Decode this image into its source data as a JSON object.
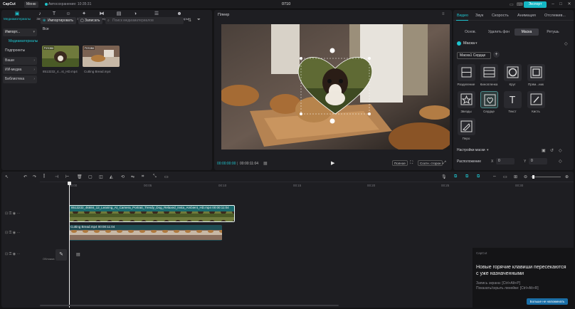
{
  "titlebar": {
    "logo": "CapCut",
    "menu": "Меню",
    "autosave": "Автосохранение: 10:35:31",
    "project_title": "0710",
    "export": "Экспорт"
  },
  "media": {
    "tabs": [
      {
        "label": "Медиаматериалы",
        "icon": "media-icon"
      },
      {
        "label": "Звук",
        "icon": "audio-icon"
      },
      {
        "label": "Текст",
        "icon": "text-icon"
      },
      {
        "label": "Стикеры",
        "icon": "sticker-icon"
      },
      {
        "label": "Эффекты",
        "icon": "effects-icon"
      },
      {
        "label": "Переходы",
        "icon": "transitions-icon"
      },
      {
        "label": "Субтитры",
        "icon": "captions-icon"
      },
      {
        "label": "Фильтры",
        "icon": "filters-icon"
      },
      {
        "label": "Корректировка",
        "icon": "adjust-icon"
      },
      {
        "label": "ИИ-аватары",
        "icon": "avatar-icon"
      }
    ],
    "sidebar": [
      {
        "label": "Импорт..."
      },
      {
        "label": "Медиаматериалы"
      },
      {
        "label": "Подпроекты"
      },
      {
        "label": "Ваши"
      },
      {
        "label": "ИИ-медиа"
      },
      {
        "label": "Библиотека"
      }
    ],
    "import_label": "Импортировать",
    "record_label": "Записать",
    "search_placeholder": "Поиск медиаматериалов",
    "all_label": "Все",
    "clips": [
      {
        "badge": "Готово",
        "name": "8513232_4...st_HD.mp4"
      },
      {
        "badge": "Готово",
        "name": "Cutting Bread.mp4"
      }
    ]
  },
  "player": {
    "title": "Плеер",
    "time_current": "00:00:00:00",
    "time_total": "00:00:11:04",
    "btn_full": "Полное",
    "btn_ratio": "Соотн. сторон"
  },
  "props": {
    "tabs": [
      "Видео",
      "Звук",
      "Скорость",
      "Анимация",
      "Отслежив..."
    ],
    "subtabs": [
      "Основ.",
      "Удалить фон",
      "Маска",
      "Ретушь"
    ],
    "mask_header": "Маска",
    "mask_selected": "Маска1 Сердце",
    "masks": [
      {
        "label": "Разделение",
        "icon": "split-mask-icon"
      },
      {
        "label": "Кинопленка",
        "icon": "filmstrip-mask-icon"
      },
      {
        "label": "Круг",
        "icon": "circle-mask-icon"
      },
      {
        "label": "Прям...ник",
        "icon": "rectangle-mask-icon"
      },
      {
        "label": "Звезды",
        "icon": "star-mask-icon"
      },
      {
        "label": "Сердце",
        "icon": "heart-mask-icon"
      },
      {
        "label": "Текст",
        "icon": "text-mask-icon"
      },
      {
        "label": "Кисть",
        "icon": "brush-mask-icon"
      },
      {
        "label": "Перо",
        "icon": "pen-mask-icon"
      }
    ],
    "mask_settings": "Настройки маски",
    "position_label": "Расположение",
    "pos_x_label": "X",
    "pos_x": "0",
    "pos_y_label": "Y",
    "pos_y": "0"
  },
  "timeline": {
    "ruler": [
      "00:00",
      "00:05",
      "00:10",
      "00:15",
      "00:20",
      "00:25",
      "00:30"
    ],
    "clips": [
      {
        "label": "8513232_4k684_12_Leaning_At_Camera_Portrait_Trendy_Dog_Relaxed_Insta_Ambient_HD.mp4  00:00:11:04"
      },
      {
        "label": "Cutting Bread.mp4  00:00:11:04"
      }
    ],
    "cover_label": "Обложка"
  },
  "toast": {
    "app": "CapCut",
    "title": "Новые горячие клавиши пересекаются с уже назначенными",
    "line1": "Запись экрана: [Ctrl+Alt+P]",
    "line2": "Показать/скрыть линейки: [Ctrl+Alt+R]",
    "button": "Больше не напоминать"
  },
  "colors": {
    "accent": "#1ec4cf",
    "export": "#14b7c4",
    "clip_main": "#1a6a6e"
  }
}
